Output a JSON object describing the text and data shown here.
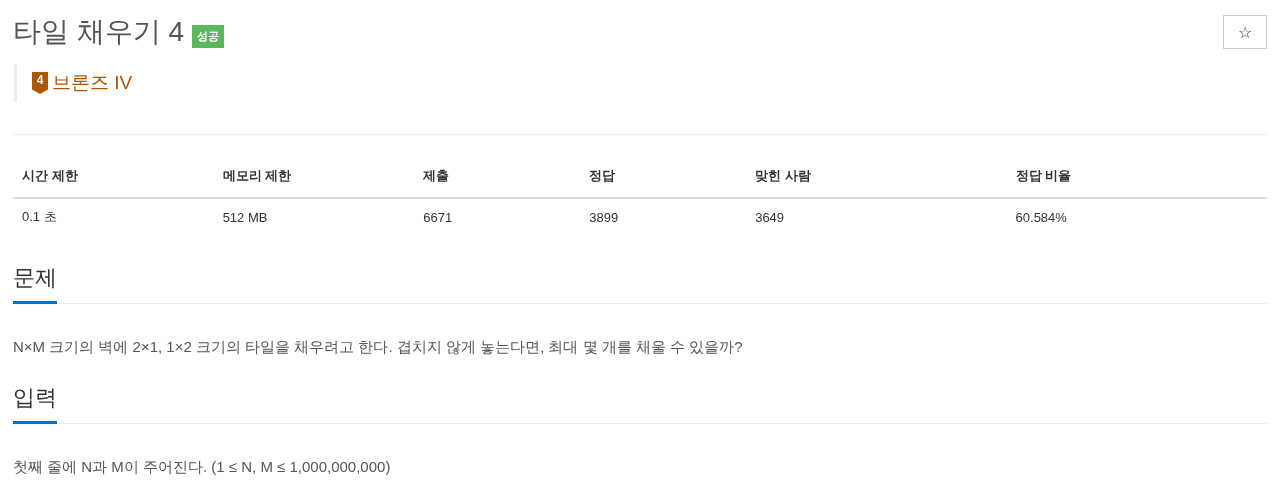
{
  "title": "타일 채우기 4",
  "result_badge": "성공",
  "star_button": {
    "label": "☆"
  },
  "tier": {
    "badge": "4",
    "label": "브론즈 IV"
  },
  "stats": {
    "columns": [
      "시간 제한",
      "메모리 제한",
      "제출",
      "정답",
      "맞힌 사람",
      "정답 비율"
    ],
    "rows": [
      [
        "0.1 초",
        "512 MB",
        "6671",
        "3899",
        "3649",
        "60.584%"
      ]
    ]
  },
  "sections": [
    {
      "heading": "문제",
      "text": "N×M 크기의 벽에 2×1, 1×2 크기의 타일을 채우려고 한다. 겹치지 않게 놓는다면, 최대 몇 개를 채울 수 있을까?"
    },
    {
      "heading": "입력",
      "text": "첫째 줄에 N과 M이 주어진다. (1 ≤ N, M ≤ 1,000,000,000)"
    }
  ]
}
